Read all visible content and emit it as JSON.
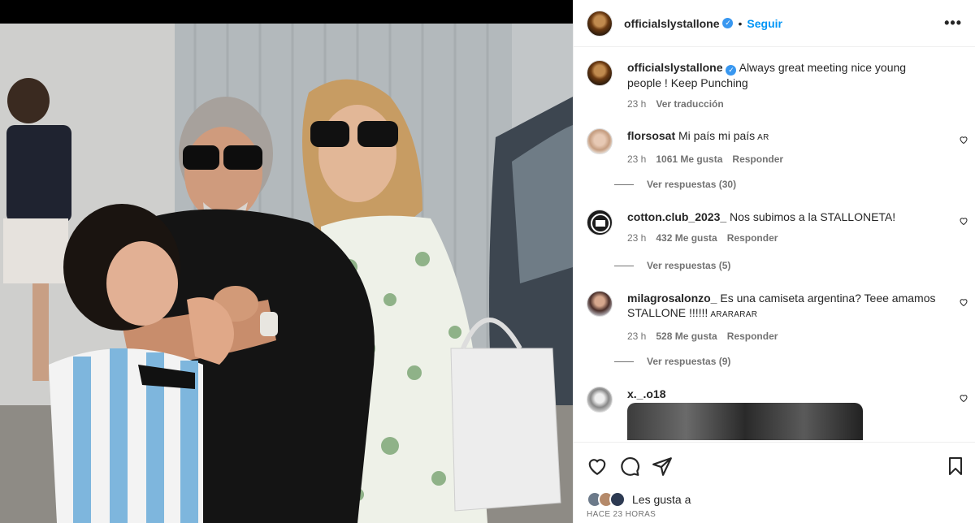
{
  "post": {
    "username": "officialslystallone",
    "follow_label": "Seguir",
    "more_label": "•••",
    "caption": "Always great meeting nice young people ! Keep Punching",
    "caption_time": "23 h",
    "translate_label": "Ver traducción"
  },
  "comments": [
    {
      "username": "florsosat",
      "text": "Mi país mi país",
      "tag": "AR",
      "time": "23 h",
      "likes": "1061 Me gusta",
      "reply": "Responder",
      "view_replies": "Ver respuestas (30)"
    },
    {
      "username": "cotton.club_2023_",
      "text": "Nos subimos a la STALLONETA!",
      "tag": "",
      "time": "23 h",
      "likes": "432 Me gusta",
      "reply": "Responder",
      "view_replies": "Ver respuestas (5)"
    },
    {
      "username": "milagrosalonzo_",
      "text": "Es una camiseta argentina? Teee amamos STALLONE !!!!!!",
      "tag": "ARARARAR",
      "time": "23 h",
      "likes": "528 Me gusta",
      "reply": "Responder",
      "view_replies": "Ver respuestas (9)"
    },
    {
      "username": "x._.o18",
      "text": ""
    }
  ],
  "footer": {
    "likes_label": "Les gusta a",
    "time_ago": "HACE 23 HORAS"
  },
  "icons": {
    "like": "heart-icon",
    "comment": "comment-icon",
    "share": "send-icon",
    "save": "bookmark-icon"
  },
  "colors": {
    "accent": "#0095f6",
    "verified": "#3897f0",
    "muted": "#737373"
  }
}
